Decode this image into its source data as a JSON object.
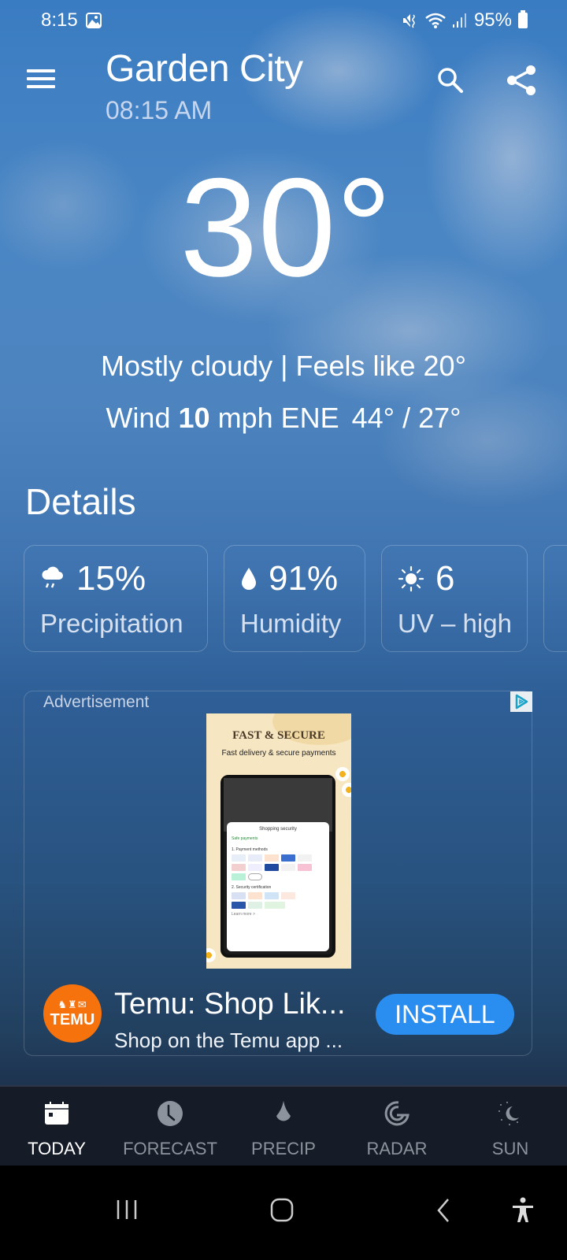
{
  "status_bar": {
    "time": "8:15",
    "battery": "95%",
    "icons": [
      "gallery-icon",
      "mute-vibrate-icon",
      "wifi-icon",
      "signal-icon",
      "battery-icon"
    ]
  },
  "header": {
    "city": "Garden City",
    "time": "08:15 AM",
    "menu_icon": "hamburger-icon",
    "search_icon": "search-icon",
    "share_icon": "share-icon"
  },
  "current": {
    "temperature": "30°",
    "condition": "Mostly cloudy",
    "separator": "|",
    "feels_like": "Feels like 20°",
    "wind_label": "Wind",
    "wind_speed": "10",
    "wind_unit_dir": "mph ENE",
    "hi_lo": "44° / 27°"
  },
  "details": {
    "title": "Details",
    "cards": [
      {
        "icon": "rain-cloud-icon",
        "value": "15%",
        "label": "Precipitation"
      },
      {
        "icon": "droplet-icon",
        "value": "91%",
        "label": "Humidity"
      },
      {
        "icon": "sun-icon",
        "value": "6",
        "label": "UV – high"
      }
    ]
  },
  "ad": {
    "label": "Advertisement",
    "image_headline": "FAST & SECURE",
    "image_subhead": "Fast delivery & secure payments",
    "sheet_title": "Shopping security",
    "sheet_safe": "Safe payments",
    "sheet_methods": "1. Payment methods",
    "sheet_cert": "2. Security certification",
    "sheet_learn": "Learn more >",
    "logo_text": "TEMU",
    "title": "Temu: Shop Lik...",
    "subtitle": "Shop on the Temu app ...",
    "install_label": "INSTALL",
    "brand_color": "#f6720d",
    "button_color": "#2a8ef0"
  },
  "bottom_nav": {
    "items": [
      {
        "label": "TODAY",
        "icon": "calendar-icon",
        "active": true
      },
      {
        "label": "FORECAST",
        "icon": "clock-icon",
        "active": false
      },
      {
        "label": "PRECIP",
        "icon": "droplet-icon",
        "active": false
      },
      {
        "label": "RADAR",
        "icon": "radar-icon",
        "active": false
      },
      {
        "label": "SUN",
        "icon": "sun-moon-icon",
        "active": false
      }
    ]
  },
  "system_nav": {
    "recents": "recents-icon",
    "home": "home-icon",
    "back": "back-icon",
    "accessibility": "accessibility-icon"
  }
}
